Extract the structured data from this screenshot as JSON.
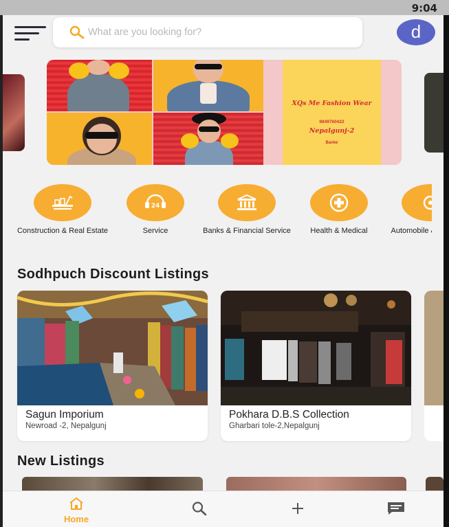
{
  "status_bar": {
    "time": "9:04"
  },
  "header": {
    "search": {
      "placeholder": "What are you looking for?"
    },
    "avatar_letter": "d",
    "avatar_color": "#5a65c6"
  },
  "banner": {
    "line1": "XQs Me Fashion Wear",
    "phone": "9849760422",
    "location": "Nepalgunj-2",
    "tagline": "Banke"
  },
  "categories": [
    {
      "label": "Construction & Real Estate",
      "icon": "construction-icon"
    },
    {
      "label": "Service",
      "icon": "service-24-icon"
    },
    {
      "label": "Banks & Financial Service",
      "icon": "bank-icon"
    },
    {
      "label": "Health & Medical",
      "icon": "medical-icon"
    },
    {
      "label": "Automobile & Transport",
      "icon": "automobile-icon"
    }
  ],
  "discount_section": {
    "title": "Sodhpuch Discount Listings",
    "listings": [
      {
        "name": "Sagun Imporium",
        "address": "Newroad -2, Nepalgunj"
      },
      {
        "name": "Pokhara D.B.S Collection",
        "address": "Gharbari tole-2,Nepalgunj"
      }
    ]
  },
  "new_section": {
    "title": "New Listings"
  },
  "bottom_nav": {
    "home_label": "Home",
    "active_color": "#f7a823"
  }
}
